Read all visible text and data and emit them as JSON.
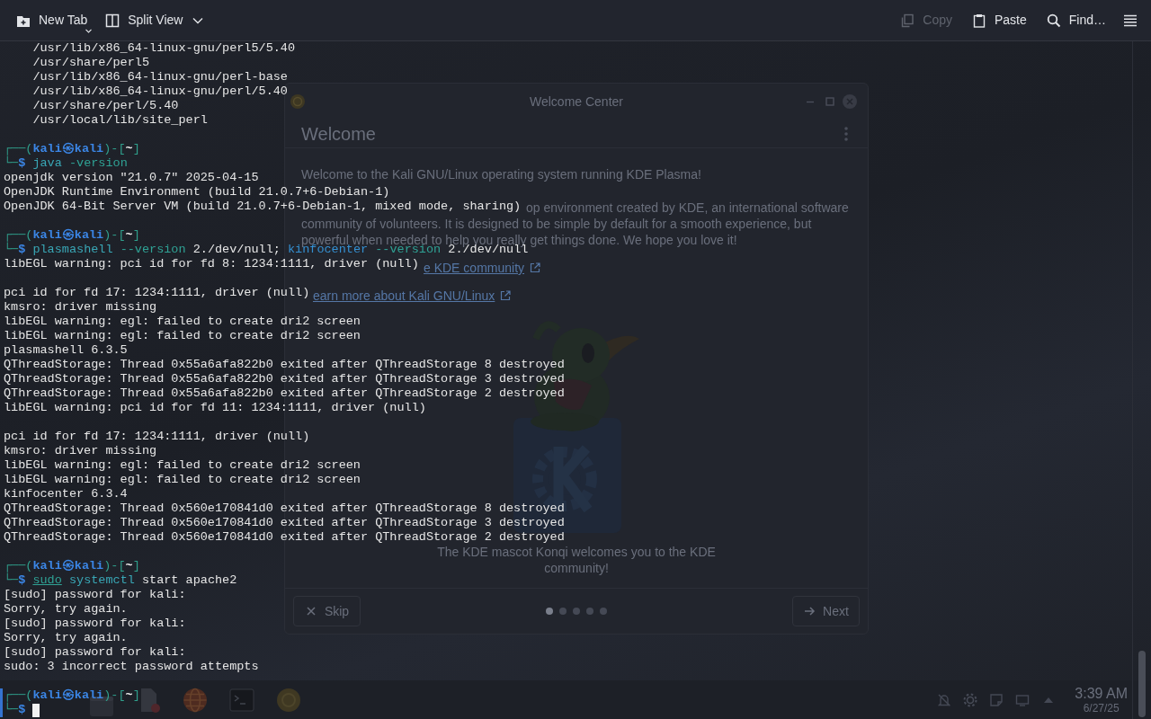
{
  "toolbar": {
    "buttons": [
      {
        "kind": "new_tab",
        "label": "New Tab",
        "disabled": false
      },
      {
        "kind": "split_view",
        "label": "Split View",
        "disabled": false
      },
      {
        "kind": "copy",
        "label": "Copy",
        "disabled": true
      },
      {
        "kind": "paste",
        "label": "Paste",
        "disabled": false
      },
      {
        "kind": "find",
        "label": "Find…",
        "disabled": false
      },
      {
        "kind": "menu",
        "disabled": false
      }
    ]
  },
  "terminal": {
    "lines": [
      {
        "kind": "output",
        "text": "    /usr/lib/x86_64-linux-gnu/perl5/5.40"
      },
      {
        "kind": "output",
        "text": "    /usr/share/perl5"
      },
      {
        "kind": "output",
        "text": "    /usr/lib/x86_64-linux-gnu/perl-base"
      },
      {
        "kind": "output",
        "text": "    /usr/lib/x86_64-linux-gnu/perl/5.40"
      },
      {
        "kind": "output",
        "text": "    /usr/share/perl/5.40"
      },
      {
        "kind": "output",
        "text": "    /usr/local/lib/site_perl"
      },
      {
        "kind": "blank"
      },
      {
        "kind": "prompt",
        "header": [
          {
            "kind": "frame",
            "text": "┌──("
          },
          {
            "kind": "user",
            "text": "kali㉿kali"
          },
          {
            "kind": "frame",
            "text": ")-["
          },
          {
            "kind": "dir",
            "text": "~"
          },
          {
            "kind": "frame",
            "text": "]"
          }
        ],
        "corner": "└─",
        "symbol": "$",
        "command": [
          {
            "kind": "command",
            "text": "java"
          },
          {
            "kind": "option",
            "text": "-version"
          }
        ],
        "active": false,
        "cursor": false
      },
      {
        "kind": "output",
        "text": "openjdk version \"21.0.7\" 2025-04-15"
      },
      {
        "kind": "output",
        "text": "OpenJDK Runtime Environment (build 21.0.7+6-Debian-1)"
      },
      {
        "kind": "output",
        "text": "OpenJDK 64-Bit Server VM (build 21.0.7+6-Debian-1, mixed mode, sharing)"
      },
      {
        "kind": "blank"
      },
      {
        "kind": "prompt",
        "header": [
          {
            "kind": "frame",
            "text": "┌──("
          },
          {
            "kind": "user",
            "text": "kali㉿kali"
          },
          {
            "kind": "frame",
            "text": ")-["
          },
          {
            "kind": "dir",
            "text": "~"
          },
          {
            "kind": "frame",
            "text": "]"
          }
        ],
        "corner": "└─",
        "symbol": "$",
        "command": [
          {
            "kind": "command",
            "text": "plasmashell"
          },
          {
            "kind": "option",
            "text": "--version"
          },
          {
            "kind": "arg",
            "text": "2./dev/null;"
          },
          {
            "kind": "program",
            "text": "kinfocenter"
          },
          {
            "kind": "option",
            "text": "--version"
          },
          {
            "kind": "arg",
            "text": "2./dev/null"
          }
        ],
        "active": false,
        "cursor": false
      },
      {
        "kind": "output",
        "text": "libEGL warning: pci id for fd 8: 1234:1111, driver (null)"
      },
      {
        "kind": "blank"
      },
      {
        "kind": "output",
        "text": "pci id for fd 17: 1234:1111, driver (null)"
      },
      {
        "kind": "output",
        "text": "kmsro: driver missing"
      },
      {
        "kind": "output",
        "text": "libEGL warning: egl: failed to create dri2 screen"
      },
      {
        "kind": "output",
        "text": "libEGL warning: egl: failed to create dri2 screen"
      },
      {
        "kind": "output",
        "text": "plasmashell 6.3.5"
      },
      {
        "kind": "output",
        "text": "QThreadStorage: Thread 0x55a6afa822b0 exited after QThreadStorage 8 destroyed"
      },
      {
        "kind": "output",
        "text": "QThreadStorage: Thread 0x55a6afa822b0 exited after QThreadStorage 3 destroyed"
      },
      {
        "kind": "output",
        "text": "QThreadStorage: Thread 0x55a6afa822b0 exited after QThreadStorage 2 destroyed"
      },
      {
        "kind": "output",
        "text": "libEGL warning: pci id for fd 11: 1234:1111, driver (null)"
      },
      {
        "kind": "blank"
      },
      {
        "kind": "output",
        "text": "pci id for fd 17: 1234:1111, driver (null)"
      },
      {
        "kind": "output",
        "text": "kmsro: driver missing"
      },
      {
        "kind": "output",
        "text": "libEGL warning: egl: failed to create dri2 screen"
      },
      {
        "kind": "output",
        "text": "libEGL warning: egl: failed to create dri2 screen"
      },
      {
        "kind": "output",
        "text": "kinfocenter 6.3.4"
      },
      {
        "kind": "output",
        "text": "QThreadStorage: Thread 0x560e170841d0 exited after QThreadStorage 8 destroyed"
      },
      {
        "kind": "output",
        "text": "QThreadStorage: Thread 0x560e170841d0 exited after QThreadStorage 3 destroyed"
      },
      {
        "kind": "output",
        "text": "QThreadStorage: Thread 0x560e170841d0 exited after QThreadStorage 2 destroyed"
      },
      {
        "kind": "blank"
      },
      {
        "kind": "prompt",
        "header": [
          {
            "kind": "frame",
            "text": "┌──("
          },
          {
            "kind": "user",
            "text": "kali㉿kali"
          },
          {
            "kind": "frame",
            "text": ")-["
          },
          {
            "kind": "dir",
            "text": "~"
          },
          {
            "kind": "frame",
            "text": "]"
          }
        ],
        "corner": "└─",
        "symbol": "$",
        "command": [
          {
            "kind": "precommand",
            "text": "sudo"
          },
          {
            "kind": "command",
            "text": "systemctl"
          },
          {
            "kind": "arg",
            "text": "start"
          },
          {
            "kind": "arg",
            "text": "apache2"
          }
        ],
        "active": false,
        "cursor": false
      },
      {
        "kind": "output",
        "text": "[sudo] password for kali:"
      },
      {
        "kind": "output",
        "text": "Sorry, try again."
      },
      {
        "kind": "output",
        "text": "[sudo] password for kali:"
      },
      {
        "kind": "output",
        "text": "Sorry, try again."
      },
      {
        "kind": "output",
        "text": "[sudo] password for kali:"
      },
      {
        "kind": "output",
        "text": "sudo: 3 incorrect password attempts"
      },
      {
        "kind": "blank"
      },
      {
        "kind": "prompt",
        "header": [
          {
            "kind": "frame",
            "text": "┌──("
          },
          {
            "kind": "user",
            "text": "kali㉿kali"
          },
          {
            "kind": "frame",
            "text": ")-["
          },
          {
            "kind": "dir",
            "text": "~"
          },
          {
            "kind": "frame",
            "text": "]"
          }
        ],
        "corner": "└─",
        "symbol": "$",
        "active": true,
        "cursor": true
      }
    ]
  },
  "desktop": {
    "welcome_window": {
      "title": "Welcome Center",
      "heading": "Welcome",
      "intro": "Welcome to the Kali GNU/Linux operating system running KDE Plasma!",
      "paragraph_lines": [
        "op environment created by KDE, an international software",
        "community of volunteers. It is designed to be simple by default for a smooth experience, but",
        "powerful when needed to help you really get things done. We hope you love it!"
      ],
      "links": [
        {
          "kind": "community",
          "text": "e KDE community"
        },
        {
          "kind": "about",
          "text": "earn more about Kali GNU/Linux"
        }
      ],
      "caption": "The KDE mascot Konqi welcomes you to the KDE community!",
      "buttons": [
        {
          "kind": "skip",
          "label": "Skip"
        },
        {
          "kind": "next",
          "label": "Next"
        }
      ],
      "pages": [
        {
          "selected": true
        },
        {
          "selected": false
        },
        {
          "selected": false
        },
        {
          "selected": false
        },
        {
          "selected": false
        }
      ]
    },
    "taskbar": {
      "apps": [
        {
          "kind": "window"
        },
        {
          "kind": "document"
        },
        {
          "kind": "browser"
        },
        {
          "kind": "terminal"
        },
        {
          "kind": "welcome"
        }
      ],
      "tray": [
        {
          "kind": "notifications_off"
        },
        {
          "kind": "brightness"
        },
        {
          "kind": "notes"
        },
        {
          "kind": "display"
        },
        {
          "kind": "expand"
        }
      ],
      "clock": {
        "time": "3:39 AM",
        "date": "6/27/25"
      }
    }
  }
}
